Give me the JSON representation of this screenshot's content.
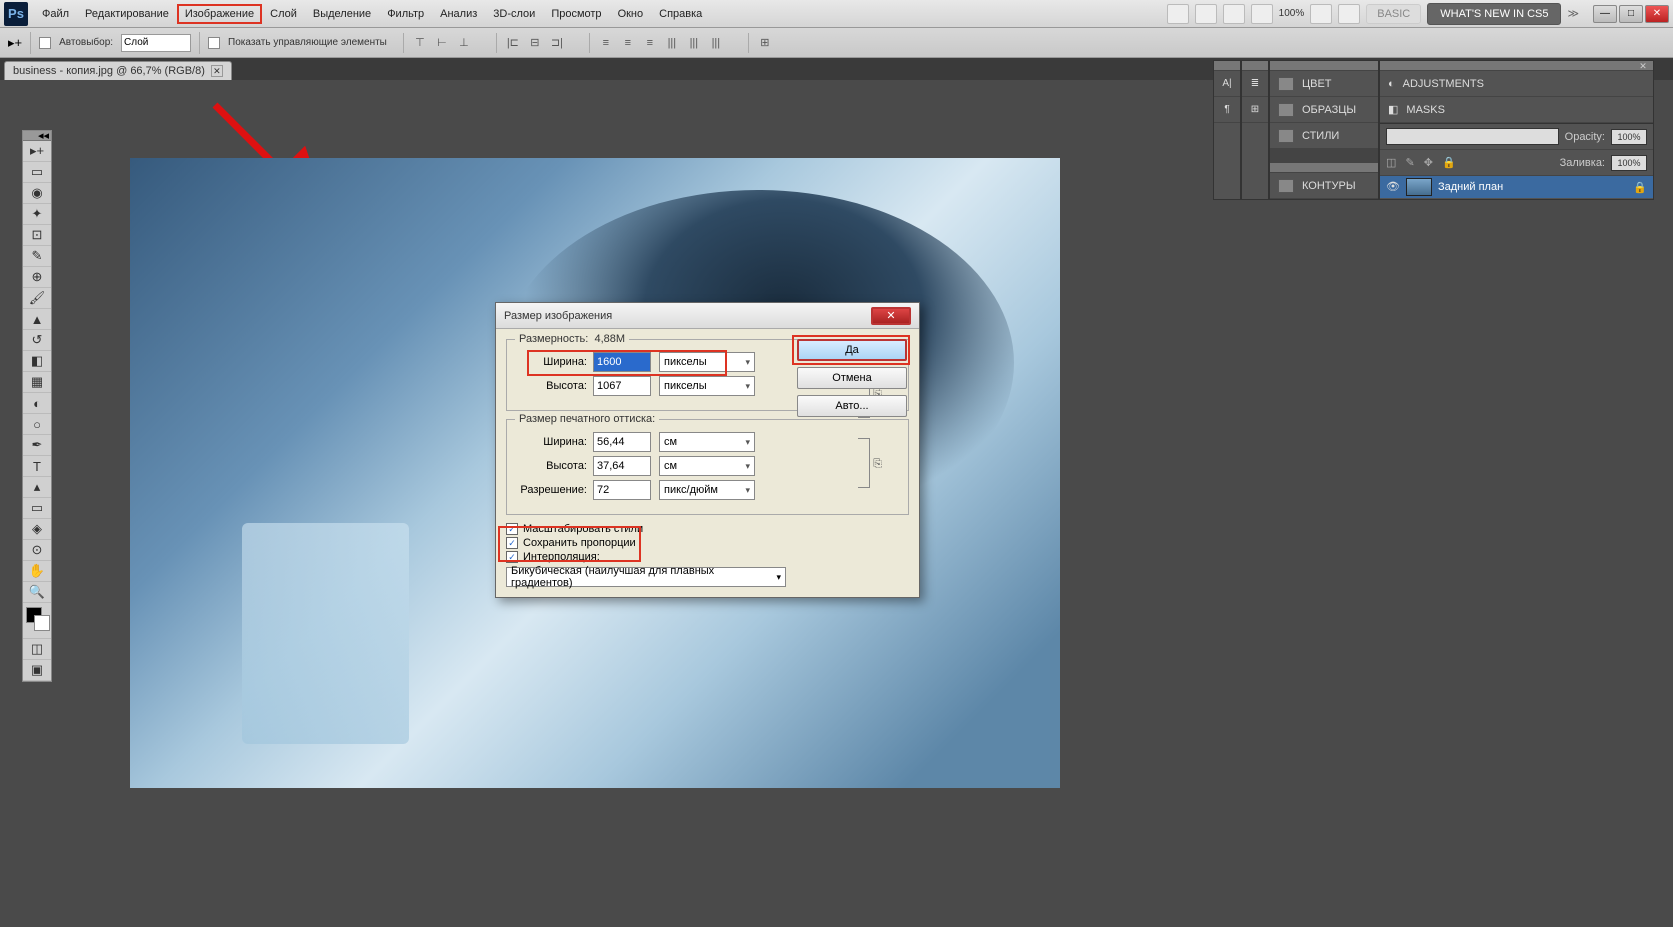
{
  "menubar": {
    "items": [
      "Файл",
      "Редактирование",
      "Изображение",
      "Слой",
      "Выделение",
      "Фильтр",
      "Анализ",
      "3D-слои",
      "Просмотр",
      "Окно",
      "Справка"
    ],
    "highlighted_index": 2,
    "zoom": "100%",
    "basic": "BASIC",
    "whatsnew": "WHAT'S NEW IN CS5"
  },
  "optbar": {
    "autoselect": "Автовыбор:",
    "autoselect_value": "Слой",
    "showcontrols": "Показать управляющие элементы"
  },
  "doctab": "business - копия.jpg @ 66,7% (RGB/8)",
  "dialog": {
    "title": "Размер изображения",
    "dim_legend": "Размерность:",
    "dim_size": "4,88M",
    "width_label": "Ширина:",
    "width_value": "1600",
    "height_label": "Высота:",
    "height_value": "1067",
    "pixels_unit": "пикселы",
    "print_legend": "Размер печатного оттиска:",
    "print_width": "56,44",
    "print_height": "37,64",
    "cm_unit": "см",
    "res_label": "Разрешение:",
    "res_value": "72",
    "res_unit": "пикс/дюйм",
    "scale_styles": "Масштабировать стили",
    "constrain": "Сохранить пропорции",
    "interp_label": "Интерполяция:",
    "interp_value": "Бикубическая (наилучшая для плавных градиентов)",
    "ok": "Да",
    "cancel": "Отмена",
    "auto": "Авто..."
  },
  "panels": {
    "col1": [
      "A|",
      "¶"
    ],
    "col2_icons": [
      "≣",
      "⊞"
    ],
    "col3": [
      "ЦВЕТ",
      "ОБРАЗЦЫ",
      "СТИЛИ",
      "КОНТУРЫ"
    ],
    "adjustments": "ADJUSTMENTS",
    "masks": "MASKS",
    "opacity_label": "Opacity:",
    "opacity": "100%",
    "fill_label": "Заливка:",
    "fill": "100%",
    "layer_name": "Задний план"
  }
}
